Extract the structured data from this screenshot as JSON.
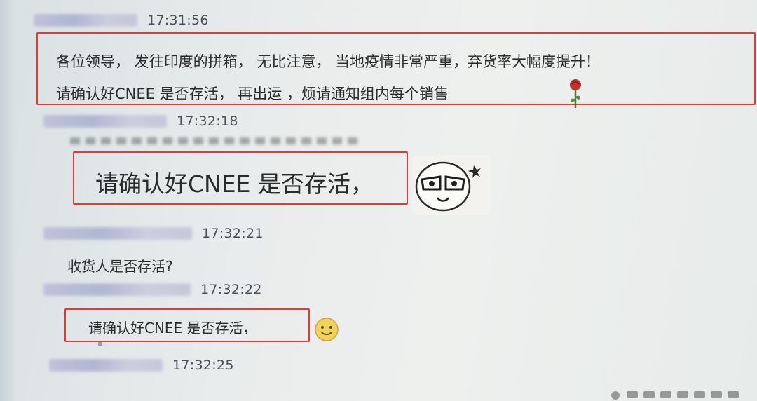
{
  "messages": [
    {
      "time": "17:31:56",
      "lines": [
        "各位领导，   发往印度的拼箱，  无比注意，  当地疫情非常严重，弃货率大幅度提升！",
        "请确认好CNEE 是否存活，  再出运   ，烦请通知组内每个销售"
      ],
      "sticker": "rose-icon"
    },
    {
      "time": "17:32:18",
      "lines": [
        "请确认好CNEE 是否存活，"
      ],
      "sticker": "meme-face-icon"
    },
    {
      "time": "17:32:21",
      "lines": [
        "收货人是否存活?"
      ]
    },
    {
      "time": "17:32:22",
      "lines": [
        "请确认好CNEE 是否存活，"
      ],
      "sticker": "smile-emoji-icon"
    },
    {
      "time": "17:32:25",
      "lines": []
    }
  ],
  "colors": {
    "highlight_box": "#e23a36",
    "timestamp": "#4a4e58"
  }
}
